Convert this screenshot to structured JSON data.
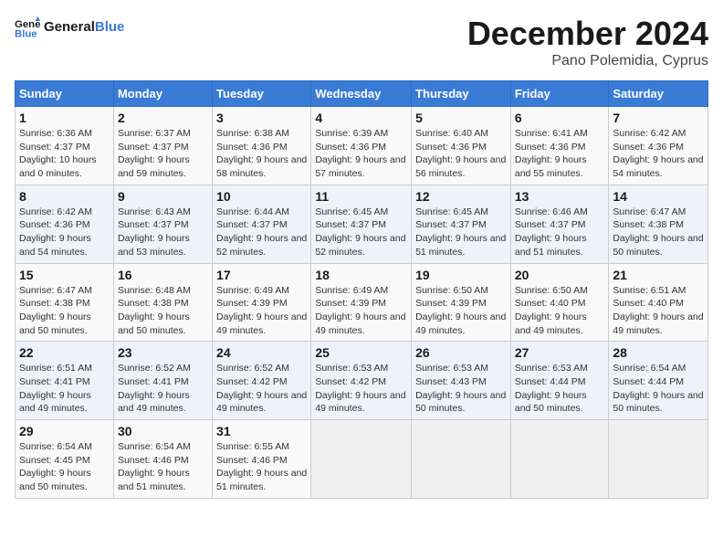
{
  "header": {
    "logo_general": "General",
    "logo_blue": "Blue",
    "month": "December 2024",
    "location": "Pano Polemidia, Cyprus"
  },
  "days_of_week": [
    "Sunday",
    "Monday",
    "Tuesday",
    "Wednesday",
    "Thursday",
    "Friday",
    "Saturday"
  ],
  "weeks": [
    [
      {
        "day": "1",
        "sunrise": "6:36 AM",
        "sunset": "4:37 PM",
        "daylight": "10 hours and 0 minutes."
      },
      {
        "day": "2",
        "sunrise": "6:37 AM",
        "sunset": "4:37 PM",
        "daylight": "9 hours and 59 minutes."
      },
      {
        "day": "3",
        "sunrise": "6:38 AM",
        "sunset": "4:36 PM",
        "daylight": "9 hours and 58 minutes."
      },
      {
        "day": "4",
        "sunrise": "6:39 AM",
        "sunset": "4:36 PM",
        "daylight": "9 hours and 57 minutes."
      },
      {
        "day": "5",
        "sunrise": "6:40 AM",
        "sunset": "4:36 PM",
        "daylight": "9 hours and 56 minutes."
      },
      {
        "day": "6",
        "sunrise": "6:41 AM",
        "sunset": "4:36 PM",
        "daylight": "9 hours and 55 minutes."
      },
      {
        "day": "7",
        "sunrise": "6:42 AM",
        "sunset": "4:36 PM",
        "daylight": "9 hours and 54 minutes."
      }
    ],
    [
      {
        "day": "8",
        "sunrise": "6:42 AM",
        "sunset": "4:36 PM",
        "daylight": "9 hours and 54 minutes."
      },
      {
        "day": "9",
        "sunrise": "6:43 AM",
        "sunset": "4:37 PM",
        "daylight": "9 hours and 53 minutes."
      },
      {
        "day": "10",
        "sunrise": "6:44 AM",
        "sunset": "4:37 PM",
        "daylight": "9 hours and 52 minutes."
      },
      {
        "day": "11",
        "sunrise": "6:45 AM",
        "sunset": "4:37 PM",
        "daylight": "9 hours and 52 minutes."
      },
      {
        "day": "12",
        "sunrise": "6:45 AM",
        "sunset": "4:37 PM",
        "daylight": "9 hours and 51 minutes."
      },
      {
        "day": "13",
        "sunrise": "6:46 AM",
        "sunset": "4:37 PM",
        "daylight": "9 hours and 51 minutes."
      },
      {
        "day": "14",
        "sunrise": "6:47 AM",
        "sunset": "4:38 PM",
        "daylight": "9 hours and 50 minutes."
      }
    ],
    [
      {
        "day": "15",
        "sunrise": "6:47 AM",
        "sunset": "4:38 PM",
        "daylight": "9 hours and 50 minutes."
      },
      {
        "day": "16",
        "sunrise": "6:48 AM",
        "sunset": "4:38 PM",
        "daylight": "9 hours and 50 minutes."
      },
      {
        "day": "17",
        "sunrise": "6:49 AM",
        "sunset": "4:39 PM",
        "daylight": "9 hours and 49 minutes."
      },
      {
        "day": "18",
        "sunrise": "6:49 AM",
        "sunset": "4:39 PM",
        "daylight": "9 hours and 49 minutes."
      },
      {
        "day": "19",
        "sunrise": "6:50 AM",
        "sunset": "4:39 PM",
        "daylight": "9 hours and 49 minutes."
      },
      {
        "day": "20",
        "sunrise": "6:50 AM",
        "sunset": "4:40 PM",
        "daylight": "9 hours and 49 minutes."
      },
      {
        "day": "21",
        "sunrise": "6:51 AM",
        "sunset": "4:40 PM",
        "daylight": "9 hours and 49 minutes."
      }
    ],
    [
      {
        "day": "22",
        "sunrise": "6:51 AM",
        "sunset": "4:41 PM",
        "daylight": "9 hours and 49 minutes."
      },
      {
        "day": "23",
        "sunrise": "6:52 AM",
        "sunset": "4:41 PM",
        "daylight": "9 hours and 49 minutes."
      },
      {
        "day": "24",
        "sunrise": "6:52 AM",
        "sunset": "4:42 PM",
        "daylight": "9 hours and 49 minutes."
      },
      {
        "day": "25",
        "sunrise": "6:53 AM",
        "sunset": "4:42 PM",
        "daylight": "9 hours and 49 minutes."
      },
      {
        "day": "26",
        "sunrise": "6:53 AM",
        "sunset": "4:43 PM",
        "daylight": "9 hours and 50 minutes."
      },
      {
        "day": "27",
        "sunrise": "6:53 AM",
        "sunset": "4:44 PM",
        "daylight": "9 hours and 50 minutes."
      },
      {
        "day": "28",
        "sunrise": "6:54 AM",
        "sunset": "4:44 PM",
        "daylight": "9 hours and 50 minutes."
      }
    ],
    [
      {
        "day": "29",
        "sunrise": "6:54 AM",
        "sunset": "4:45 PM",
        "daylight": "9 hours and 50 minutes."
      },
      {
        "day": "30",
        "sunrise": "6:54 AM",
        "sunset": "4:46 PM",
        "daylight": "9 hours and 51 minutes."
      },
      {
        "day": "31",
        "sunrise": "6:55 AM",
        "sunset": "4:46 PM",
        "daylight": "9 hours and 51 minutes."
      },
      null,
      null,
      null,
      null
    ]
  ],
  "labels": {
    "sunrise": "Sunrise: ",
    "sunset": "Sunset: ",
    "daylight": "Daylight: "
  }
}
